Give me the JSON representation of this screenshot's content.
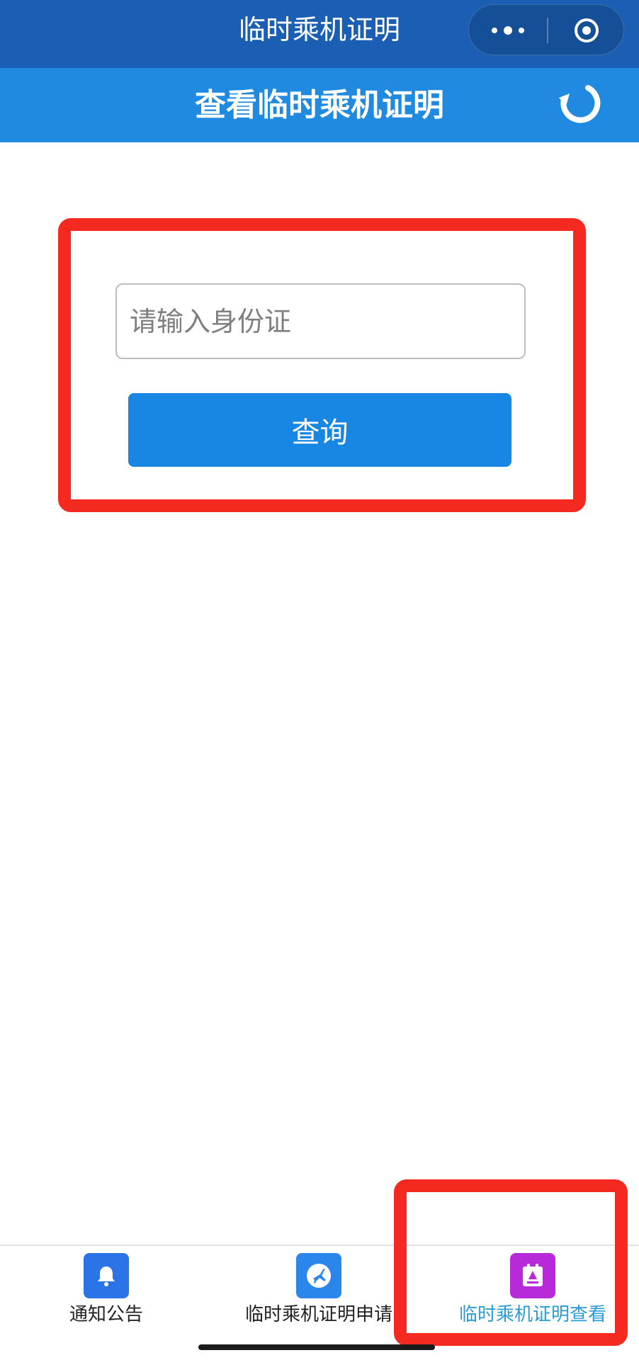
{
  "topbar": {
    "title": "临时乘机证明"
  },
  "header": {
    "title": "查看临时乘机证明"
  },
  "search": {
    "placeholder": "请输入身份证",
    "button_label": "查询"
  },
  "tabs": [
    {
      "label": "通知公告",
      "icon": "bell-icon",
      "color": "#2b74e8",
      "selected": false
    },
    {
      "label": "临时乘机证明申请",
      "icon": "airplane-icon",
      "color": "#2b86eb",
      "selected": false
    },
    {
      "label": "临时乘机证明查看",
      "icon": "id-card-icon",
      "color": "#b82ad9",
      "selected": true
    }
  ],
  "colors": {
    "topbar": "#1a5fb4",
    "header": "#2089e0",
    "button": "#1787e3",
    "annotation": "#f42a20",
    "active_tab_text": "#2b9bd7"
  }
}
